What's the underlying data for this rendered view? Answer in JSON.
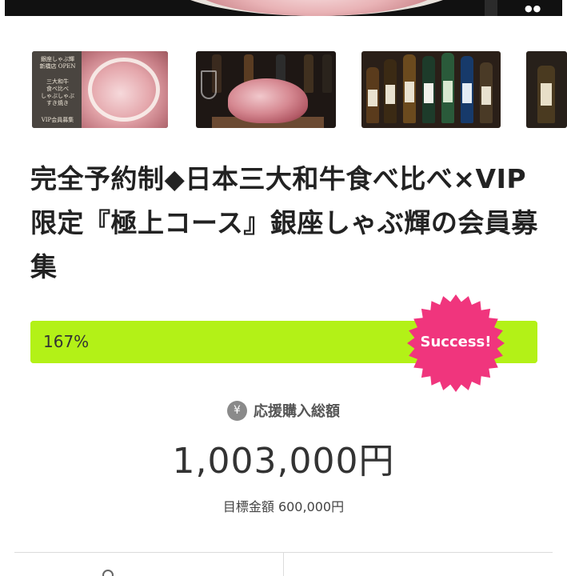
{
  "hero": {
    "page_dots": "●●"
  },
  "thumbnails": [
    {
      "name": "thumb-shop-open",
      "lines": [
        "銀座しゃぶ輝",
        "新橋店 OPEN",
        "",
        "三大和牛",
        "食べ比べ",
        "しゃぶしゃぶ",
        "すき焼き",
        "",
        "VIP会員募集"
      ]
    },
    {
      "name": "thumb-beef-block"
    },
    {
      "name": "thumb-sake-bottles"
    },
    {
      "name": "thumb-sake-bottle"
    }
  ],
  "title": "完全予約制◆日本三大和牛食べ比べ×VIP限定『極上コース』銀座しゃぶ輝の会員募集",
  "progress": {
    "percent_label": "167%",
    "percent": 167
  },
  "badge": {
    "label": "Success!"
  },
  "amount": {
    "icon": "yen-icon",
    "icon_glyph": "¥",
    "label": "応援購入総額",
    "value": "1,003,000円"
  },
  "goal": {
    "text": "目標金額 600,000円"
  },
  "colors": {
    "progress": "#b3f117",
    "badge": "#f0357d",
    "text": "#222222"
  }
}
